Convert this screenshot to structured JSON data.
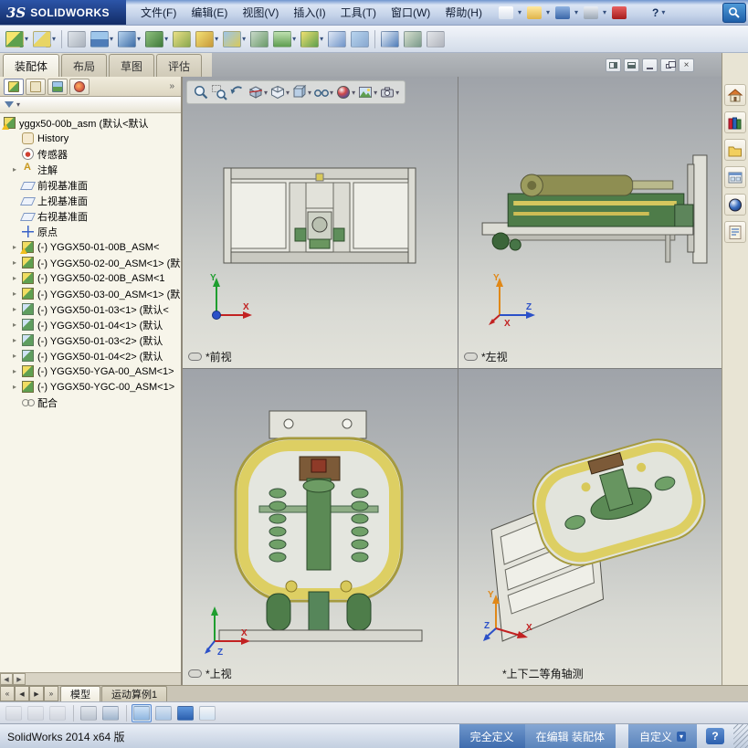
{
  "titlebar": {
    "logo_mark": "3S",
    "logo_text": "SOLIDWORKS",
    "menus": [
      {
        "label": "文件(F)"
      },
      {
        "label": "编辑(E)"
      },
      {
        "label": "视图(V)"
      },
      {
        "label": "插入(I)"
      },
      {
        "label": "工具(T)"
      },
      {
        "label": "窗口(W)"
      },
      {
        "label": "帮助(H)"
      }
    ],
    "quick_icons": [
      {
        "name": "new-document-icon",
        "bg": "linear-gradient(#ffffff,#d8e0ec)",
        "caret": true
      },
      {
        "name": "open-folder-icon",
        "bg": "linear-gradient(#ffe9a0,#dfb44a)",
        "caret": true
      },
      {
        "name": "save-icon",
        "bg": "linear-gradient(#8fb2e0,#3a66a8)",
        "caret": true
      },
      {
        "name": "print-icon",
        "bg": "linear-gradient(#eceff4,#9aa6b4)",
        "caret": true
      },
      {
        "name": "red-badge-icon",
        "bg": "linear-gradient(#e86060,#a51c1c)"
      },
      {
        "name": "help-icon",
        "label": "?",
        "caret": true
      }
    ]
  },
  "toolbar": {
    "icons": [
      {
        "name": "insert-components-icon",
        "bg": "linear-gradient(135deg,#f5e56d 45%,#5ea04e 45%)",
        "caret": true
      },
      {
        "name": "mate-icon",
        "bg": "linear-gradient(135deg,#cfe0f2 40%,#e8d564 40%)",
        "caret": true
      },
      {
        "type": "sep"
      },
      {
        "name": "fastener-clip-icon",
        "bg": "linear-gradient(135deg,#dfe4ea,#aab2bc)"
      },
      {
        "name": "linear-component-pattern-icon",
        "bg": "linear-gradient(180deg,#9ec6ea 50%,#4e7cb8 50%)",
        "caret": true
      },
      {
        "name": "smart-fasteners-icon",
        "bg": "linear-gradient(135deg,#b8d4ee,#3f6ea8)",
        "caret": true
      },
      {
        "name": "move-component-icon",
        "bg": "linear-gradient(135deg,#8fc07e,#3f7a3a)",
        "caret": true
      },
      {
        "name": "show-hidden-components-icon",
        "bg": "linear-gradient(135deg,#eadf86,#8aa84e)"
      },
      {
        "name": "assembly-features-icon",
        "bg": "linear-gradient(135deg,#f2e074,#c89a3a)",
        "caret": true
      },
      {
        "name": "reference-geometry-icon",
        "bg": "linear-gradient(135deg,#9ec6ea,#d8c95a)",
        "caret": true
      },
      {
        "name": "new-motion-study-icon",
        "bg": "linear-gradient(135deg,#c8d8c8,#6a9a6a)"
      },
      {
        "name": "bill-of-materials-icon",
        "bg": "linear-gradient(180deg,#bfe0b0,#5e9e50)",
        "caret": true
      },
      {
        "name": "exploded-view-icon",
        "bg": "linear-gradient(135deg,#f0e070,#5ea04e)",
        "caret": true
      },
      {
        "name": "explode-line-sketch-icon",
        "bg": "linear-gradient(135deg,#dfe8f5,#6f94c8)"
      },
      {
        "name": "interference-detection-icon",
        "bg": "linear-gradient(135deg,#b8d4ee,#88a8d0)"
      },
      {
        "type": "sep"
      },
      {
        "name": "measure-icon",
        "bg": "linear-gradient(135deg,#e8eef6,#4e7cb8)"
      },
      {
        "name": "mass-properties-icon",
        "bg": "linear-gradient(135deg,#d8e0d0,#7a9a8a)"
      },
      {
        "name": "section-properties-icon",
        "bg": "linear-gradient(135deg,#e4e6ea,#b0b4bc)"
      }
    ]
  },
  "command_tabs": [
    {
      "label": "装配体",
      "active": true
    },
    {
      "label": "布局"
    },
    {
      "label": "草图"
    },
    {
      "label": "评估"
    }
  ],
  "tree": {
    "overflow_glyph": "»",
    "root": {
      "label": "yggx50-00b_asm (默认<默认"
    },
    "items": [
      {
        "label": "History",
        "type": "history"
      },
      {
        "label": "传感器",
        "type": "sensors"
      },
      {
        "label": "注解",
        "type": "annotations",
        "expand": true
      },
      {
        "label": "前视基准面",
        "type": "plane"
      },
      {
        "label": "上视基准面",
        "type": "plane"
      },
      {
        "label": "右视基准面",
        "type": "plane"
      },
      {
        "label": "原点",
        "type": "origin"
      },
      {
        "label": "(-) YGGX50-01-00B_ASM<",
        "type": "assembly",
        "expand": true,
        "warn": true
      },
      {
        "label": "(-) YGGX50-02-00_ASM<1> (默认",
        "type": "assembly",
        "expand": true
      },
      {
        "label": "(-) YGGX50-02-00B_ASM<1",
        "type": "assembly",
        "expand": true
      },
      {
        "label": "(-) YGGX50-03-00_ASM<1> (默",
        "type": "assembly",
        "expand": true
      },
      {
        "label": "(-) YGGX50-01-03<1> (默认<",
        "type": "part",
        "expand": true
      },
      {
        "label": "(-) YGGX50-01-04<1> (默认",
        "type": "part",
        "expand": true
      },
      {
        "label": "(-) YGGX50-01-03<2> (默认",
        "type": "part",
        "expand": true
      },
      {
        "label": "(-) YGGX50-01-04<2> (默认",
        "type": "part",
        "expand": true
      },
      {
        "label": "(-) YGGX50-YGA-00_ASM<1>",
        "type": "assembly",
        "expand": true
      },
      {
        "label": "(-) YGGX50-YGC-00_ASM<1>",
        "type": "assembly",
        "expand": true
      },
      {
        "label": "配合",
        "type": "mates"
      }
    ]
  },
  "viewports": {
    "front": {
      "label": "*前视",
      "axes": [
        "Y",
        "X"
      ]
    },
    "left": {
      "label": "*左视",
      "axes": [
        "Y",
        "Z",
        "X"
      ]
    },
    "top": {
      "label": "*上视",
      "axes": [
        "X",
        "Z"
      ]
    },
    "iso": {
      "label": "*上下二等角轴测",
      "axes": [
        "Y",
        "X",
        "Z"
      ]
    }
  },
  "model_tabs": {
    "tabs": [
      {
        "label": "模型",
        "active": true
      },
      {
        "label": "运动算例1"
      }
    ]
  },
  "toolbar3": {
    "icons": [
      {
        "name": "selection-filter-icon",
        "bg": "linear-gradient(#eef0f4,#c9ccd4)",
        "disabled": true
      },
      {
        "name": "filter-vertices-icon",
        "bg": "linear-gradient(#eef0f4,#c9ccd4)",
        "disabled": true
      },
      {
        "name": "filter-edges-icon",
        "bg": "linear-gradient(#eef0f4,#c9ccd4)",
        "disabled": true
      },
      {
        "type": "sep"
      },
      {
        "name": "filter-faces-icon",
        "bg": "linear-gradient(#e4e8ee,#b9c2ce)"
      },
      {
        "name": "magnifying-lens-icon",
        "bg": "linear-gradient(#dfe6f0,#9fb4cc)"
      },
      {
        "type": "sep"
      },
      {
        "name": "assembly-visualization-icon",
        "bg": "linear-gradient(#cfe2f6,#8fb6e0)",
        "active": true
      },
      {
        "name": "performance-evaluation-icon",
        "bg": "linear-gradient(#d8e4f2,#a8c4e4)"
      },
      {
        "name": "mate-status-icon",
        "bg": "linear-gradient(#5f97dd,#2b5fae)"
      },
      {
        "name": "bom-table-icon",
        "bg": "linear-gradient(#f4f6f8,#cfe0f0)"
      }
    ]
  },
  "statusbar": {
    "app_version": "SolidWorks 2014 x64 版",
    "define_state": "完全定义",
    "edit_state": "在编辑 装配体",
    "custom": "自定义",
    "help": "?"
  }
}
